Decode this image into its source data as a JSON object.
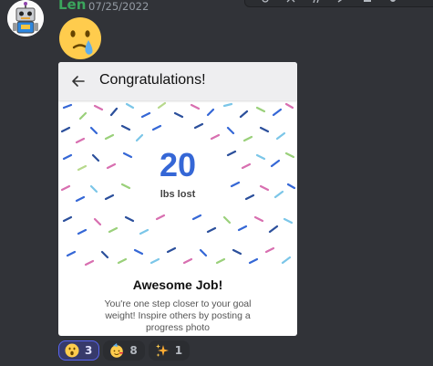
{
  "message": {
    "username": "Len",
    "timestamp": "07/25/2022",
    "emoji_icon": "sad-tear-face-emoji",
    "avatar_icon": "robot-avatar"
  },
  "card": {
    "title": "Congratulations!",
    "number": "20",
    "unit": "lbs lost",
    "headline": "Awesome Job!",
    "body_line1": "You're one step closer to your goal",
    "body_line2": "weight! Inspire others by posting a",
    "body_line3": "progress photo"
  },
  "reactions": [
    {
      "emoji": "astonished-face",
      "count": "3",
      "active": true
    },
    {
      "emoji": "partying-face",
      "count": "8",
      "active": false
    },
    {
      "emoji": "sparkles",
      "count": "1",
      "active": false
    }
  ],
  "colors": {
    "username": "#3ba55c",
    "accent_number": "#3567d6",
    "reaction_active_border": "#5865f2"
  }
}
